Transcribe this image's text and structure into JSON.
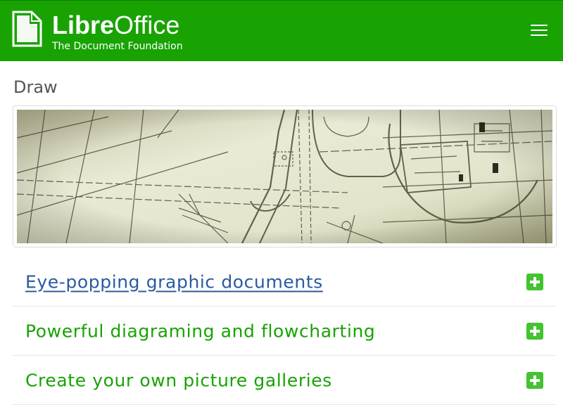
{
  "header": {
    "brand_bold": "Libre",
    "brand_light": "Office",
    "tagline": "The Document Foundation",
    "menu_icon": "hamburger-menu-icon",
    "color": "#18a303"
  },
  "page": {
    "title": "Draw",
    "hero_image": "technical-drawing-banner"
  },
  "accordion": {
    "items": [
      {
        "label": "Eye-popping graphic documents",
        "state": "link"
      },
      {
        "label": "Powerful diagraming and flowcharting",
        "state": "collapsed"
      },
      {
        "label": "Create your own picture galleries",
        "state": "collapsed"
      }
    ],
    "expand_icon": "plus-square-icon",
    "title_color": "#18a303",
    "link_color": "#2c5aa0"
  }
}
